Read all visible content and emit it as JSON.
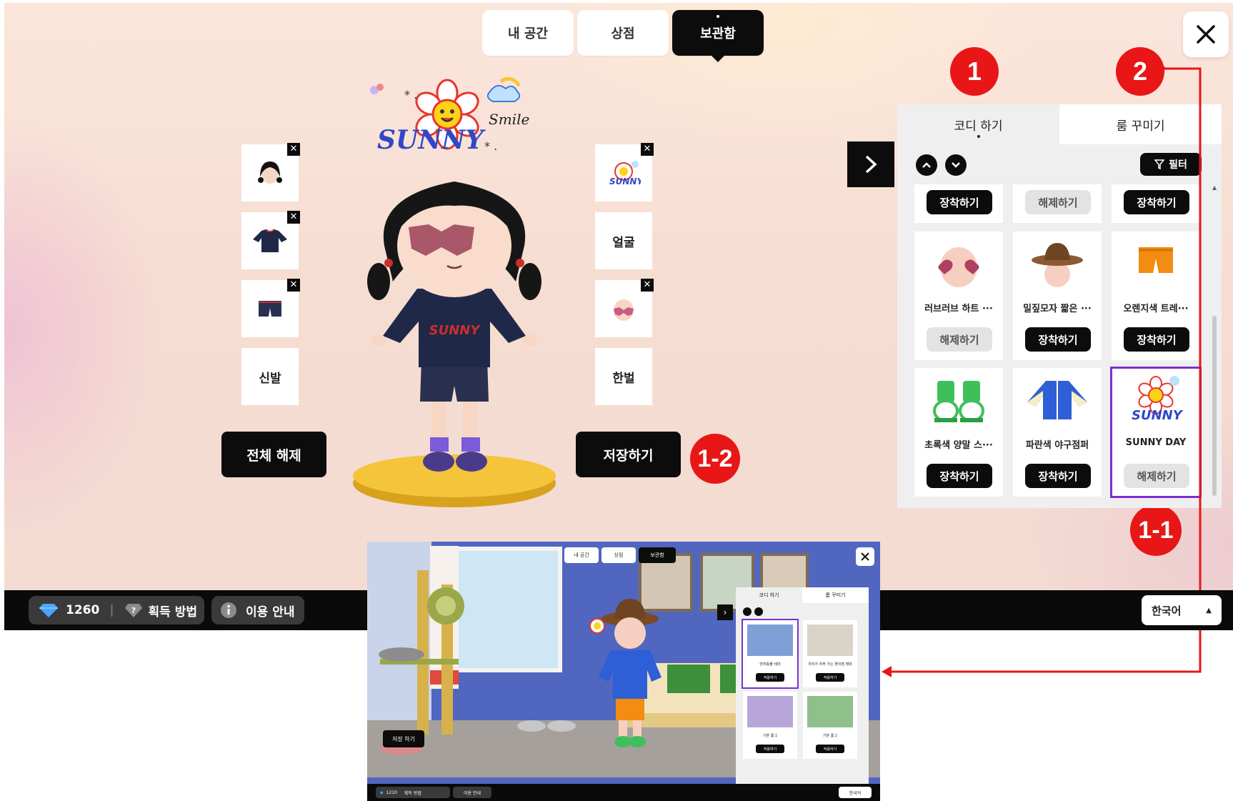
{
  "top_tabs": [
    {
      "label": "내 공간"
    },
    {
      "label": "상점"
    },
    {
      "label": "보관함"
    }
  ],
  "close_glyph": "✕",
  "left_slots": [
    {
      "label": "",
      "icon": "hair-icon",
      "removable": true
    },
    {
      "label": "",
      "icon": "shirt-icon",
      "removable": true
    },
    {
      "label": "",
      "icon": "shorts-icon",
      "removable": true
    },
    {
      "label": "신발",
      "removable": false
    }
  ],
  "right_slots": [
    {
      "label": "",
      "icon": "sunny-day-icon",
      "removable": true
    },
    {
      "label": "얼굴",
      "removable": false
    },
    {
      "label": "",
      "icon": "face-accessory-icon",
      "removable": true
    },
    {
      "label": "한벌",
      "removable": false
    }
  ],
  "sticker_text": {
    "title": "SUNNY",
    "sub": "Smile"
  },
  "buttons": {
    "unequip_all": "전체 해제",
    "save": "저장하기"
  },
  "badges": {
    "b1": "1",
    "b2": "2",
    "b11": "1-1",
    "b12": "1-2"
  },
  "panel": {
    "tabs": [
      {
        "label": "코디 하기"
      },
      {
        "label": "룸 꾸미기"
      }
    ],
    "filter_label": "필터",
    "top_row_buttons": [
      {
        "label": "장착하기",
        "style": "dark"
      },
      {
        "label": "해제하기",
        "style": "light"
      },
      {
        "label": "장착하기",
        "style": "dark"
      }
    ],
    "items": [
      {
        "name": "러브러브 하트 ···",
        "button": "해제하기",
        "style": "light",
        "icon": "heart-glasses-icon"
      },
      {
        "name": "밀짚모자 짧은 ···",
        "button": "장착하기",
        "style": "dark",
        "icon": "straw-hat-icon"
      },
      {
        "name": "오렌지색 트레···",
        "button": "장착하기",
        "style": "dark",
        "icon": "orange-shorts-icon"
      },
      {
        "name": "초록색 양말 스···",
        "button": "장착하기",
        "style": "dark",
        "icon": "green-sneakers-icon"
      },
      {
        "name": "파란색 야구점퍼",
        "button": "장착하기",
        "style": "dark",
        "icon": "blue-jacket-icon"
      },
      {
        "name": "SUNNY DAY",
        "button": "해제하기",
        "style": "light",
        "icon": "sunny-day-icon",
        "selected": true
      }
    ]
  },
  "bottom_bar": {
    "gems": "1260",
    "how_to_get": "획득 방법",
    "guide": "이용 안내",
    "language": "한국어"
  },
  "thumbnail": {
    "top_tabs": [
      "내 공간",
      "상점",
      "보관함"
    ],
    "panel_tabs": [
      "코디 하기",
      "룸 꾸미기"
    ],
    "items": [
      {
        "name": "반려동물 테마",
        "button": "적용하기"
      },
      {
        "name": "우리가 자주 가는 편의점 테마",
        "button": "적용하기"
      },
      {
        "name": "기본 룸 1",
        "button": "적용하기"
      },
      {
        "name": "기본 룸 2",
        "button": "적용하기"
      }
    ],
    "save_label": "저장 하기",
    "gems": "1210",
    "how_to_get": "획득 방법",
    "guide": "이용 안내",
    "language": "한국어"
  },
  "colors": {
    "accent_red": "#e81616",
    "selection_purple": "#7a2fd0",
    "dark": "#0c0c0c"
  }
}
